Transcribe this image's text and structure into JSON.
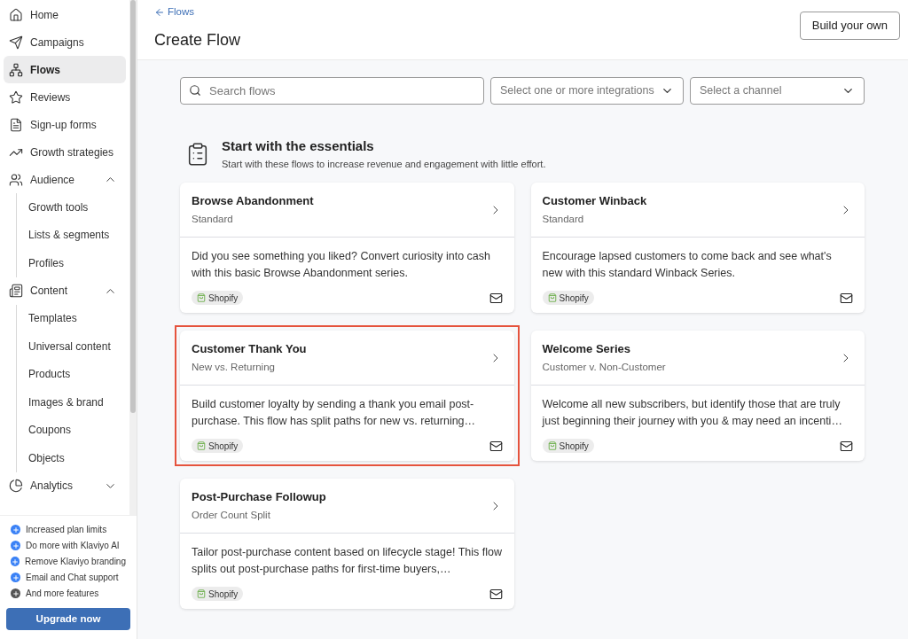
{
  "sidebar": {
    "items": [
      {
        "kind": "link",
        "label": "Home",
        "selected": false
      },
      {
        "kind": "link",
        "label": "Campaigns",
        "selected": false
      },
      {
        "kind": "link",
        "label": "Flows",
        "selected": true
      },
      {
        "kind": "link",
        "label": "Reviews",
        "selected": false
      },
      {
        "kind": "link",
        "label": "Sign-up forms",
        "selected": false
      },
      {
        "kind": "link",
        "label": "Growth strategies",
        "selected": false
      },
      {
        "kind": "group",
        "label": "Audience",
        "selected": false,
        "expanded": true,
        "children": [
          {
            "label": "Growth tools",
            "selected": false
          },
          {
            "label": "Lists & segments",
            "selected": false
          },
          {
            "label": "Profiles",
            "selected": false
          }
        ]
      },
      {
        "kind": "group",
        "label": "Content",
        "selected": false,
        "expanded": true,
        "children": [
          {
            "label": "Templates",
            "selected": false
          },
          {
            "label": "Universal content",
            "selected": false
          },
          {
            "label": "Products",
            "selected": false
          },
          {
            "label": "Images & brand",
            "selected": false
          },
          {
            "label": "Coupons",
            "selected": false
          },
          {
            "label": "Objects",
            "selected": false
          }
        ]
      },
      {
        "kind": "group",
        "label": "Analytics",
        "selected": false,
        "expanded": false
      }
    ],
    "upgrade": {
      "features": [
        {
          "label": "Increased plan limits",
          "color": "#3b82f6"
        },
        {
          "label": "Do more with Klaviyo AI",
          "color": "#3b82f6"
        },
        {
          "label": "Remove Klaviyo branding",
          "color": "#3b82f6"
        },
        {
          "label": "Email and Chat support",
          "color": "#3b82f6"
        },
        {
          "label": "And more features",
          "color": "#555555"
        }
      ],
      "button": "Upgrade now"
    }
  },
  "header": {
    "back_link": "Flows",
    "title": "Create Flow",
    "action_button": "Build your own"
  },
  "filters": {
    "search": {
      "placeholder": "Search flows"
    },
    "integrations": {
      "placeholder": "Select one or more integrations"
    },
    "channel": {
      "placeholder": "Select a channel"
    }
  },
  "section": {
    "title": "Start with the essentials",
    "subtitle": "Start with these flows to increase revenue and engagement with little effort."
  },
  "cards": [
    {
      "title": "Browse Abandonment",
      "subtitle": "Standard",
      "description": "Did you see something you liked? Convert curiosity into cash with this basic Browse Abandonment series.",
      "tag": "Shopify",
      "highlighted": false
    },
    {
      "title": "Customer Winback",
      "subtitle": "Standard",
      "description": "Encourage lapsed customers to come back and see what's new with this standard Winback Series.",
      "tag": "Shopify",
      "highlighted": false
    },
    {
      "title": "Customer Thank You",
      "subtitle": "New vs. Returning",
      "description": "Build customer loyalty by sending a thank you email post-purchase. This flow has split paths for new vs. returning…",
      "tag": "Shopify",
      "highlighted": true
    },
    {
      "title": "Welcome Series",
      "subtitle": "Customer v. Non-Customer",
      "description": "Welcome all new subscribers, but identify those that are truly just beginning their journey with you & may need an incenti…",
      "tag": "Shopify",
      "highlighted": false
    },
    {
      "title": "Post-Purchase Followup",
      "subtitle": "Order Count Split",
      "description": "Tailor post-purchase content based on lifecycle stage! This flow splits out post-purchase paths for first-time buyers,…",
      "tag": "Shopify",
      "highlighted": false
    }
  ]
}
